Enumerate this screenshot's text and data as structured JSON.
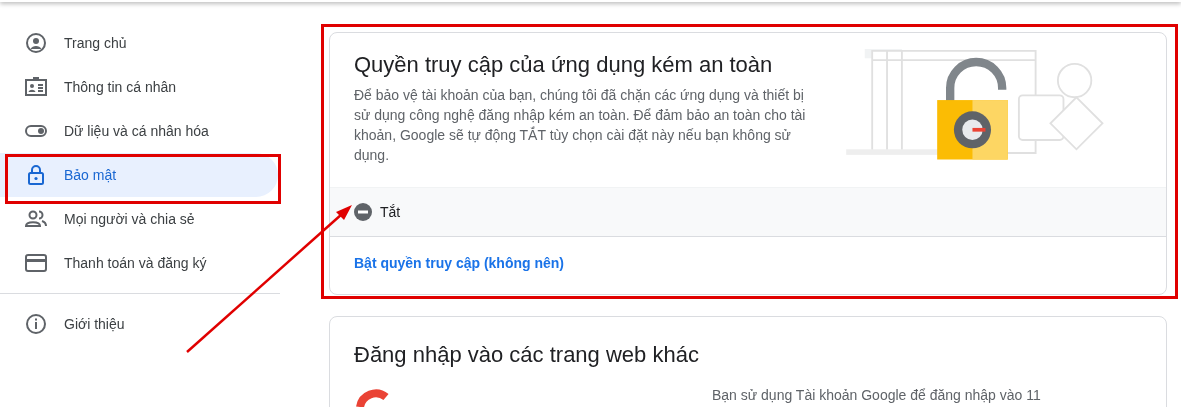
{
  "sidebar": {
    "items": [
      {
        "label": "Trang chủ",
        "selected": false
      },
      {
        "label": "Thông tin cá nhân",
        "selected": false
      },
      {
        "label": "Dữ liệu và cá nhân hóa",
        "selected": false
      },
      {
        "label": "Bảo mật",
        "selected": true
      },
      {
        "label": "Mọi người và chia sẻ",
        "selected": false
      },
      {
        "label": "Thanh toán và đăng ký",
        "selected": false
      }
    ],
    "footer_items": [
      {
        "label": "Giới thiệu",
        "selected": false
      }
    ]
  },
  "less_secure_card": {
    "title": "Quyền truy cập của ứng dụng kém an toàn",
    "description": "Để bảo vệ tài khoản của bạn, chúng tôi đã chặn các ứng dụng và thiết bị sử dụng công nghệ đăng nhập kém an toàn. Để đảm bảo an toàn cho tài khoản, Google sẽ tự động TẮT tùy chọn cài đặt này nếu bạn không sử dụng.",
    "status": {
      "label": "Tắt",
      "on": false
    },
    "action_link": "Bật quyền truy cập (không nên)"
  },
  "other_sites_card": {
    "title": "Đăng nhập vào các trang web khác",
    "description": "Bạn sử dụng Tài khoản Google để đăng nhập vào 11"
  }
}
